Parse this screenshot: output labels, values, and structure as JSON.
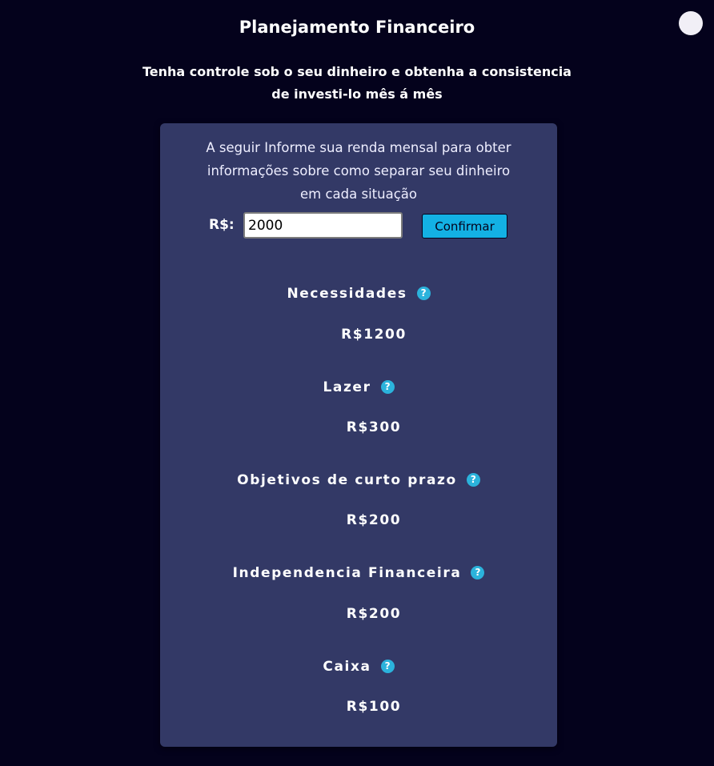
{
  "header": {
    "title": "Planejamento Financeiro",
    "subtitle_line1": "Tenha controle sob o seu dinheiro e obtenha a consistencia",
    "subtitle_line2": "de investi-lo mês á mês"
  },
  "card": {
    "intro_line1": "A seguir Informe sua renda mensal para obter",
    "intro_line2": "informações sobre como separar seu dinheiro",
    "intro_line3": "em cada situação",
    "currency_label": "R$:",
    "income_value": "2000",
    "confirm_label": "Confirmar"
  },
  "categories": [
    {
      "title": "Necessidades",
      "value": "R$1200"
    },
    {
      "title": "Lazer",
      "value": "R$300"
    },
    {
      "title": "Objetivos de curto prazo",
      "value": "R$200"
    },
    {
      "title": "Independencia Financeira",
      "value": "R$200"
    },
    {
      "title": "Caixa",
      "value": "R$100"
    }
  ],
  "icons": {
    "help": "question-mark-circle",
    "theme_toggle": "circle"
  },
  "colors": {
    "background": "#04021c",
    "card": "#333966",
    "accent": "#13b1e4",
    "help_icon": "#2bb3dc"
  }
}
